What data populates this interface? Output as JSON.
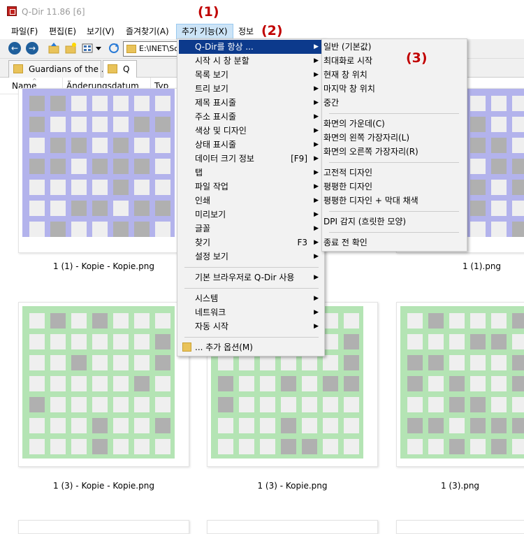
{
  "window": {
    "title": "Q-Dir 11.86 [6]"
  },
  "menubar": {
    "items": [
      "파일(F)",
      "편집(E)",
      "보기(V)",
      "즐겨찾기(A)",
      "추가 기능(X)",
      "정보"
    ],
    "annotations": [
      "(1)",
      "(2)",
      "(3)"
    ]
  },
  "toolbar": {
    "address": "E:\\INET\\So"
  },
  "tabs": [
    "Guardians of the ...",
    "Q"
  ],
  "columns": [
    "Name",
    "Änderungsdatum",
    "Typ"
  ],
  "thumbnails": [
    {
      "caption": "1 (1) - Kopie - Kopie.png",
      "color": "#b3b3ec"
    },
    {
      "caption": "1 (1).png",
      "color": "#b3b3ec"
    },
    {
      "caption": "1 (3) - Kopie - Kopie.png",
      "color": "#b4e4b4"
    },
    {
      "caption": "1 (3) - Kopie.png",
      "color": "#b4e4b4"
    },
    {
      "caption": "1 (3).png",
      "color": "#b4e4b4"
    }
  ],
  "main_menu": [
    {
      "label": "Q-Dir를 항상 ...",
      "shortcut": "",
      "arrow": true
    },
    {
      "label": "시작 시 창 분할",
      "shortcut": "",
      "arrow": true
    },
    {
      "label": "목록 보기",
      "shortcut": "",
      "arrow": true
    },
    {
      "label": "트리 보기",
      "shortcut": "",
      "arrow": true
    },
    {
      "label": "제목 표시줄",
      "shortcut": "",
      "arrow": true
    },
    {
      "label": "주소 표시줄",
      "shortcut": "",
      "arrow": true
    },
    {
      "label": "색상 및 디자인",
      "shortcut": "",
      "arrow": true
    },
    {
      "label": "상태 표시줄",
      "shortcut": "",
      "arrow": true
    },
    {
      "label": "데이터 크기 정보",
      "shortcut": "[F9]",
      "arrow": true
    },
    {
      "label": "탭",
      "shortcut": "",
      "arrow": true
    },
    {
      "label": "파일 작업",
      "shortcut": "",
      "arrow": true
    },
    {
      "label": "인쇄",
      "shortcut": "",
      "arrow": true
    },
    {
      "label": "미리보기",
      "shortcut": "",
      "arrow": true
    },
    {
      "label": "글꼴",
      "shortcut": "",
      "arrow": true
    },
    {
      "label": "찾기",
      "shortcut": "F3",
      "arrow": true
    },
    {
      "label": "설정 보기",
      "shortcut": "",
      "arrow": true
    },
    {
      "label": "기본 브라우저로 Q-Dir 사용",
      "shortcut": "",
      "arrow": true
    },
    {
      "label": "시스템",
      "shortcut": "",
      "arrow": true
    },
    {
      "label": "네트워크",
      "shortcut": "",
      "arrow": true
    },
    {
      "label": "자동 시작",
      "shortcut": "",
      "arrow": true
    },
    {
      "label": "... 추가 옵션(M)",
      "shortcut": "",
      "arrow": false
    }
  ],
  "sub_menu": [
    "일반 (기본값)",
    "최대화로 시작",
    "현재 창 위치",
    "마지막 창 위치",
    "중간",
    "화면의 가운데(C)",
    "화면의 왼쪽 가장자리(L)",
    "화면의 오른쪽 가장자리(R)",
    "고전적 디자인",
    "평평한 디자인",
    "평평한 디자인 + 막대 채색",
    "DPI 감지 (흐릿한 모양)",
    "종료 전 확인"
  ],
  "icons": {
    "back": "back-arrow-icon",
    "forward": "forward-arrow-icon",
    "up": "folder-up-icon",
    "new_folder": "new-folder-icon",
    "view": "view-mode-icon",
    "refresh": "refresh-icon",
    "submenu": "submenu-arrow-icon"
  }
}
